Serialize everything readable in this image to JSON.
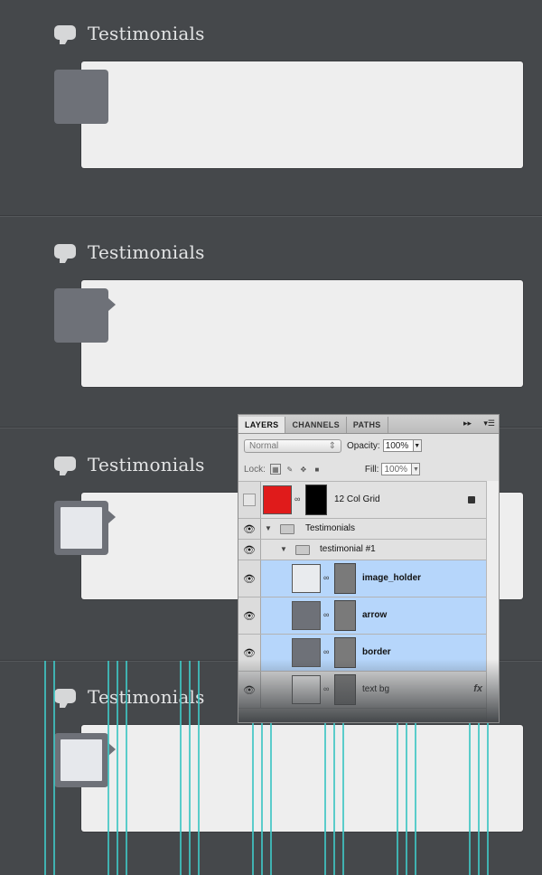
{
  "sections": [
    {
      "title": "Testimonials"
    },
    {
      "title": "Testimonials"
    },
    {
      "title": "Testimonials"
    },
    {
      "title": "Testimonials"
    }
  ],
  "colors": {
    "background": "#45484b",
    "card": "#eeeeee",
    "avatar": "#6e7178",
    "guide": "#3fc6c3",
    "selection": "#b6d6fb",
    "grid_swatch": "#e01b1b"
  },
  "panel": {
    "tabs": [
      "LAYERS",
      "CHANNELS",
      "PATHS"
    ],
    "menu_icon": "panel-menu-icon",
    "blend_mode": "Normal",
    "opacity_label": "Opacity:",
    "opacity_value": "100%",
    "lock_label": "Lock:",
    "fill_label": "Fill:",
    "fill_value": "100%",
    "layers": [
      {
        "name": "12 Col Grid",
        "visible": false,
        "locked": true
      },
      {
        "name": "Testimonials",
        "type": "group",
        "visible": true
      },
      {
        "name": "testimonial #1",
        "type": "group",
        "visible": true
      },
      {
        "name": "image_holder",
        "visible": true,
        "selected": true
      },
      {
        "name": "arrow",
        "visible": true,
        "selected": true
      },
      {
        "name": "border",
        "visible": true,
        "selected": true
      },
      {
        "name": "text bg",
        "visible": true,
        "selected": false,
        "effects": "fx"
      }
    ]
  }
}
